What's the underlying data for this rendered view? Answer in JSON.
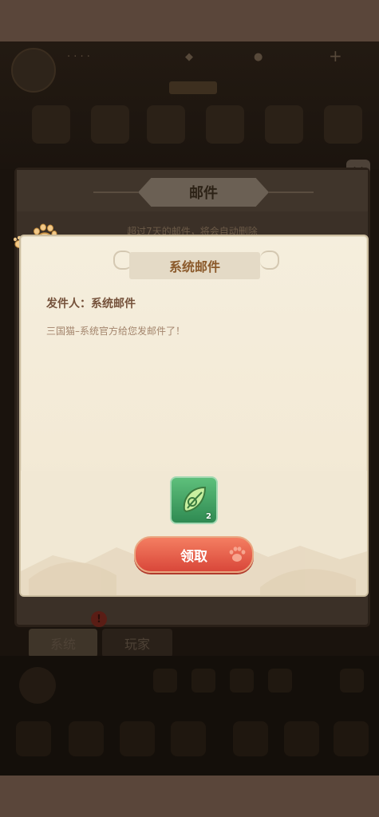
{
  "background": {
    "mail_window": {
      "title": "邮件",
      "notice": "超过7天的邮件，将会自动删除"
    },
    "tabs": [
      {
        "label": "系统"
      },
      {
        "label": "玩家"
      }
    ],
    "alert_badge": "!"
  },
  "dialog": {
    "title": "系统邮件",
    "sender": "发件人：系统邮件",
    "message": "三国猫–系统官方给您发邮件了！",
    "reward": {
      "icon": "green-leaf-item-icon",
      "count": "2"
    },
    "claim_label": "领取"
  },
  "colors": {
    "claim_button": "#e8593f",
    "dialog_bg": "#f5eedd",
    "title_text": "#8b5a2b"
  }
}
